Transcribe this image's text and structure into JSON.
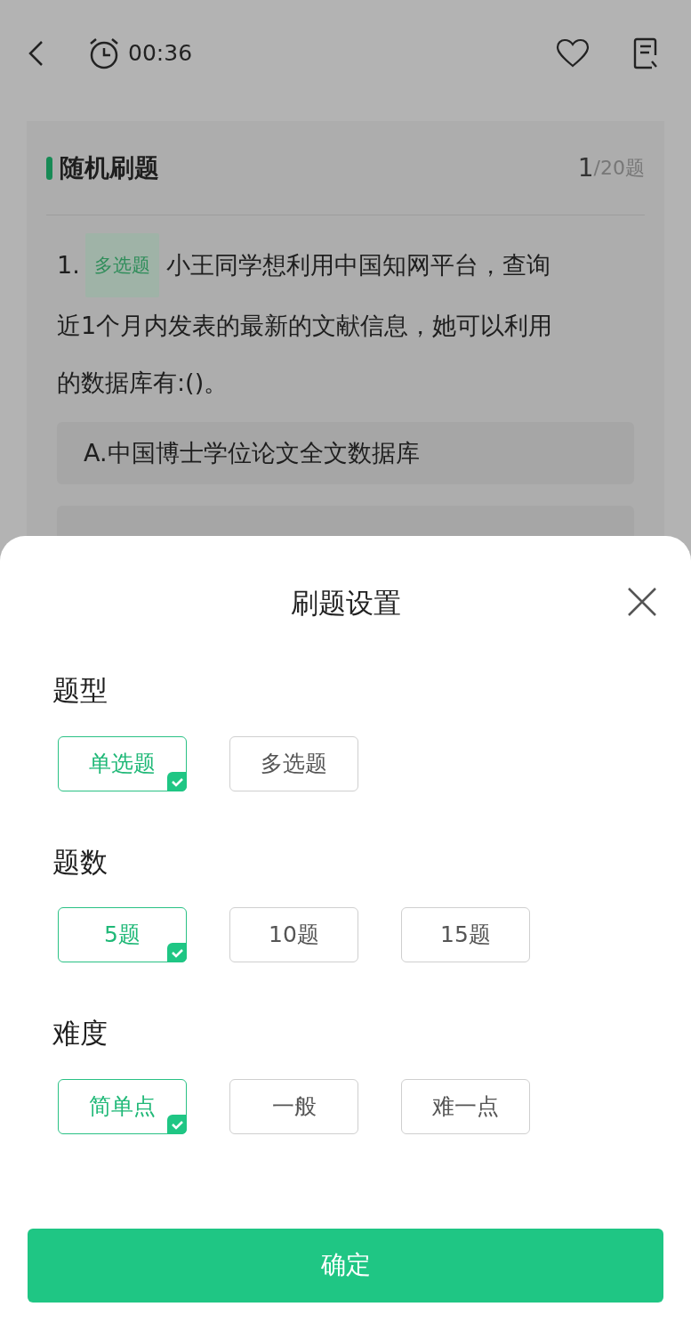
{
  "top_bar": {
    "timer": "00:36"
  },
  "card": {
    "title": "随机刷题",
    "progress_current": "1",
    "progress_total": "/20题",
    "question": {
      "number": "1.",
      "type_tag": "多选题",
      "lines": [
        "小王同学想利用中国知网平台，查询",
        "近1个月内发表的最新的文献信息，她可以利用",
        "的数据库有:()。"
      ]
    },
    "options": [
      {
        "text": "A.中国博士学位论文全文数据库"
      }
    ]
  },
  "settings_sheet": {
    "title": "刷题设置",
    "sections": [
      {
        "label": "题型",
        "choices": [
          {
            "label": "单选题",
            "selected": true
          },
          {
            "label": "多选题",
            "selected": false
          }
        ]
      },
      {
        "label": "题数",
        "choices": [
          {
            "label": "5题",
            "selected": true
          },
          {
            "label": "10题",
            "selected": false
          },
          {
            "label": "15题",
            "selected": false
          }
        ]
      },
      {
        "label": "难度",
        "choices": [
          {
            "label": "简单点",
            "selected": true
          },
          {
            "label": "一般",
            "selected": false
          },
          {
            "label": "难一点",
            "selected": false
          }
        ]
      }
    ],
    "confirm": "确定"
  }
}
